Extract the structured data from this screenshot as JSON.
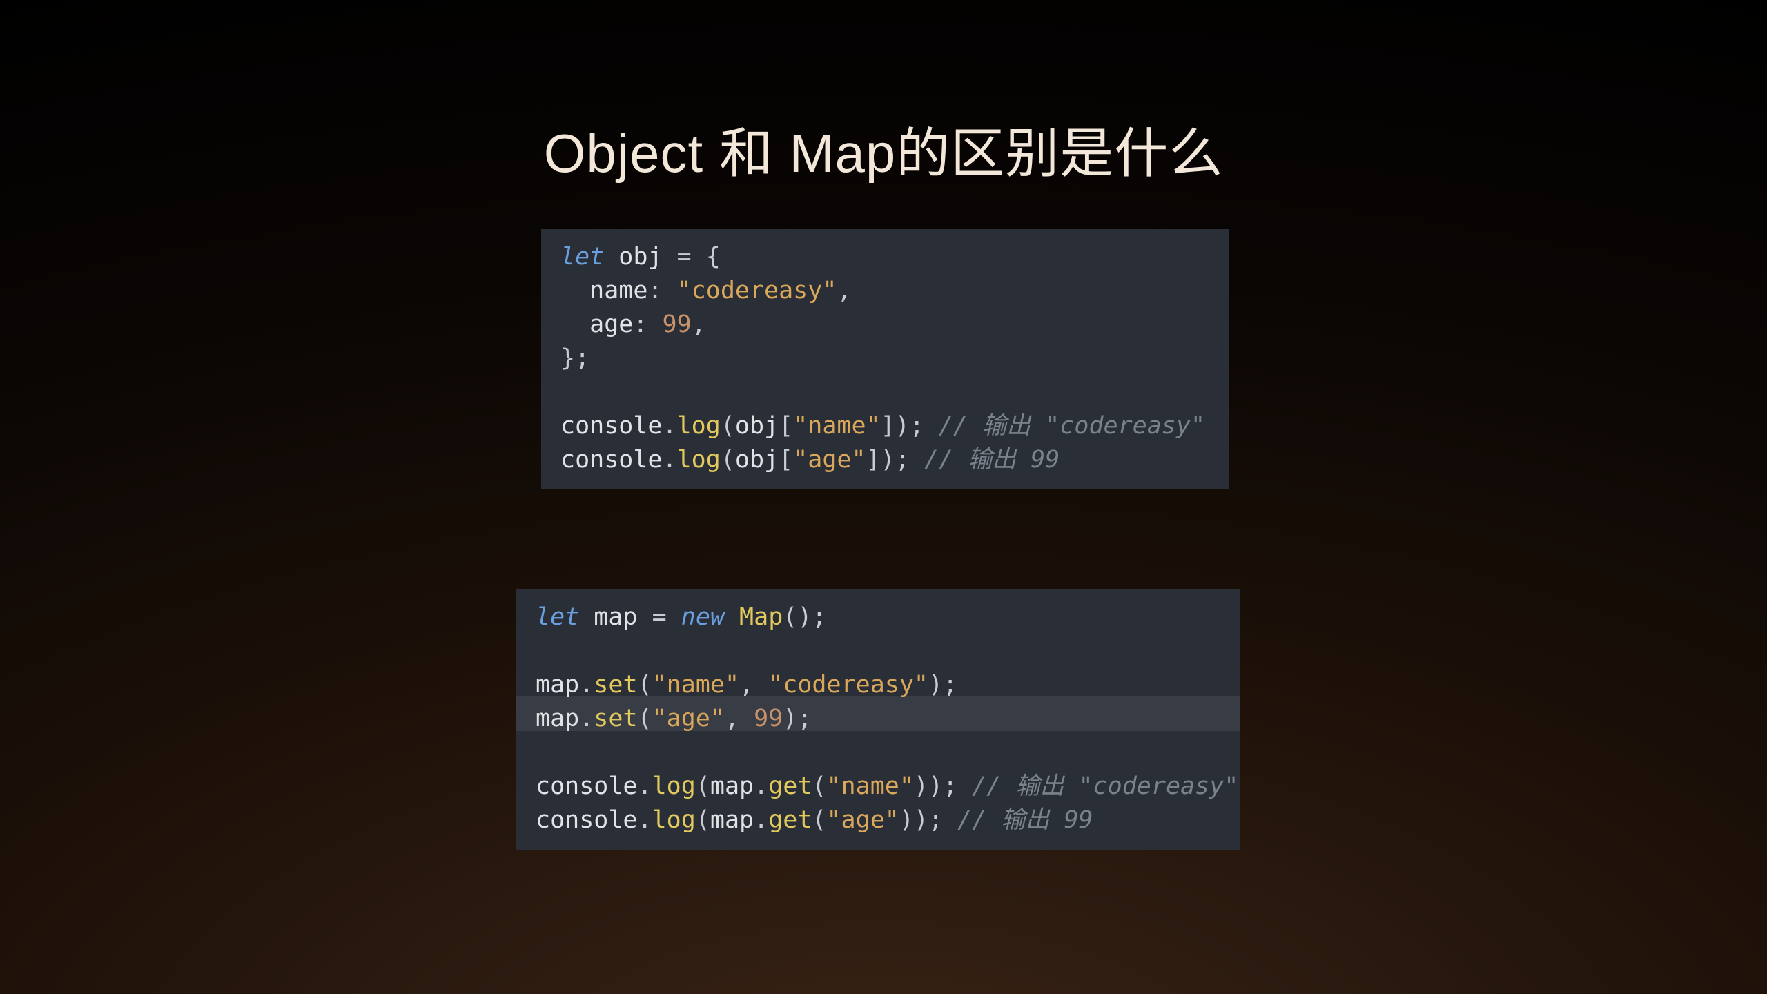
{
  "title": "Object 和 Map的区别是什么",
  "code1": {
    "tokens": {
      "let": "let",
      "obj": "obj",
      "eq": "=",
      "lb": "{",
      "name_k": "name",
      "colon": ":",
      "name_v": "\"codereasy\"",
      "comma": ",",
      "age_k": "age",
      "age_v": "99",
      "rb": "}",
      "semi": ";",
      "console": "console",
      "dot": ".",
      "log": "log",
      "lp": "(",
      "rp": ")",
      "lbr": "[",
      "rbr": "]",
      "name_s": "\"name\"",
      "age_s": "\"age\"",
      "cmt1": "// 输出 \"codereasy\"",
      "cmt2": "// 输出 99"
    }
  },
  "code2": {
    "tokens": {
      "let": "let",
      "map": "map",
      "eq": "=",
      "new": "new",
      "Map": "Map",
      "lp": "(",
      "rp": ")",
      "semi": ";",
      "dot": ".",
      "set": "set",
      "get": "get",
      "name_s": "\"name\"",
      "code_s": "\"codereasy\"",
      "age_s": "\"age\"",
      "ninetynine": "99",
      "comma": ",",
      "console": "console",
      "log": "log",
      "cmt1": "// 输出 \"codereasy\"",
      "cmt2": "// 输出 99"
    }
  }
}
